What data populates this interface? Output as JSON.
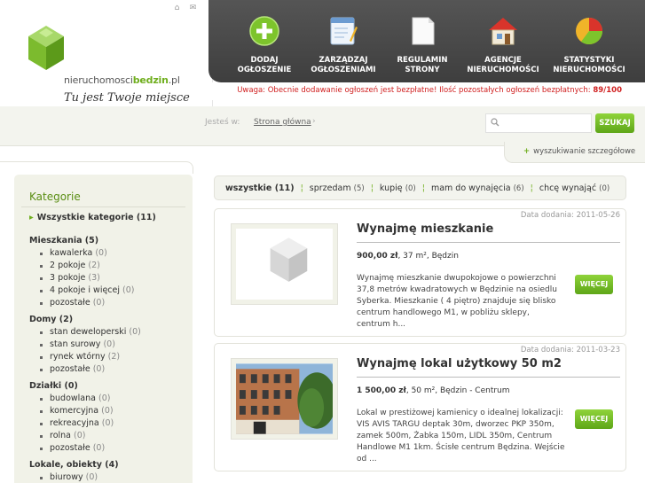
{
  "header": {
    "logo_prefix": "nieruchomosci",
    "logo_brand": "bedzin",
    "logo_suffix": ".pl",
    "slogan": "Tu jest Twoje miejsce",
    "top_icons": [
      "home-icon",
      "mail-icon"
    ],
    "nav": [
      {
        "line1": "DODAJ",
        "line2": "OGŁOSZENIE",
        "icon": "add-icon"
      },
      {
        "line1": "ZARZĄDZAJ",
        "line2": "OGŁOSZENIAMI",
        "icon": "notepad-icon"
      },
      {
        "line1": "REGULAMIN",
        "line2": "STRONY",
        "icon": "document-icon"
      },
      {
        "line1": "AGENCJE",
        "line2": "NIERUCHOMOŚCI",
        "icon": "house-icon"
      },
      {
        "line1": "STATYSTYKI",
        "line2": "NIERUCHOMOŚCI",
        "icon": "pie-chart-icon"
      }
    ],
    "notice": "Uwaga: Obecnie dodawanie ogłoszeń jest bezpłatne! Ilość pozostałych ogłoszeń bezpłatnych:",
    "notice_count": "89/100"
  },
  "breadcrumb": {
    "label": "Jesteś w:",
    "link": "Strona główna",
    "arrow": "›"
  },
  "search": {
    "value": "",
    "placeholder": "",
    "button": "SZUKAJ",
    "advanced": "wyszukiwanie szczegółowe"
  },
  "sidebar": {
    "title": "Kategorie",
    "all": "Wszystkie kategorie (11)",
    "groups": [
      {
        "name": "Mieszkania (5)",
        "items": [
          {
            "label": "kawalerka",
            "count": "(0)"
          },
          {
            "label": "2 pokoje",
            "count": "(2)"
          },
          {
            "label": "3 pokoje",
            "count": "(3)"
          },
          {
            "label": "4 pokoje i więcej",
            "count": "(0)"
          },
          {
            "label": "pozostałe",
            "count": "(0)"
          }
        ]
      },
      {
        "name": "Domy (2)",
        "items": [
          {
            "label": "stan deweloperski",
            "count": "(0)"
          },
          {
            "label": "stan surowy",
            "count": "(0)"
          },
          {
            "label": "rynek wtórny",
            "count": "(2)"
          },
          {
            "label": "pozostałe",
            "count": "(0)"
          }
        ]
      },
      {
        "name": "Działki (0)",
        "items": [
          {
            "label": "budowlana",
            "count": "(0)"
          },
          {
            "label": "komercyjna",
            "count": "(0)"
          },
          {
            "label": "rekreacyjna",
            "count": "(0)"
          },
          {
            "label": "rolna",
            "count": "(0)"
          },
          {
            "label": "pozostałe",
            "count": "(0)"
          }
        ]
      },
      {
        "name": "Lokale, obiekty (4)",
        "items": [
          {
            "label": "biurowy",
            "count": "(0)"
          }
        ]
      }
    ]
  },
  "filters": [
    {
      "label": "wszystkie",
      "count": "(11)",
      "active": true
    },
    {
      "label": "sprzedam",
      "count": "(5)"
    },
    {
      "label": "kupię",
      "count": "(0)"
    },
    {
      "label": "mam do wynajęcia",
      "count": "(6)"
    },
    {
      "label": "chcę wynająć",
      "count": "(0)"
    }
  ],
  "listings": [
    {
      "date": "Data dodania: 2011-05-26",
      "title": "Wynajmę mieszkanie",
      "price": "900,00 zł",
      "details": ", 37 m², Będzin",
      "description": "Wynajmę mieszkanie dwupokojowe o powierzchni 37,8 metrów kwadratowych w Będzinie na osiedlu Syberka. Mieszkanie ( 4 piętro) znajduje się blisko centrum handlowego M1, w pobliżu sklepy, centrum h...",
      "button": "WIĘCEJ"
    },
    {
      "date": "Data dodania: 2011-03-23",
      "title": "Wynajmę lokal użytkowy 50 m2",
      "price": "1 500,00 zł",
      "details": ", 50 m², Będzin - Centrum",
      "description": "Lokal w prestiżowej kamienicy o idealnej lokalizacji: VIS AVIS TARGU deptak 30m, dworzec PKP 350m, zamek 500m, Żabka 150m, LIDL 350m, Centrum Handlowe M1 1km. Ścisłe centrum Będzina. Wejście od ...",
      "button": "WIĘCEJ"
    }
  ],
  "colors": {
    "accent_green": "#6fae1d",
    "header_dark": "#474747",
    "notice_red": "#d02020"
  }
}
